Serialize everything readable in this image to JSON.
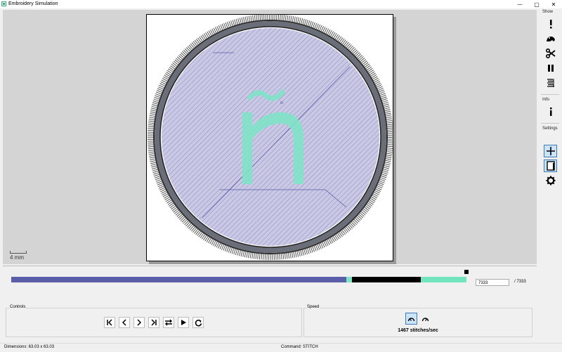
{
  "window": {
    "title": "Embroidery Simulation",
    "controls": {
      "minimize": "—",
      "maximize": "▢",
      "close": "✕"
    }
  },
  "canvas": {
    "scale_label": "4 mm",
    "colors": {
      "background": "#d4d4d4",
      "fill_stitch": "#c8c8e6",
      "satin_border": "#3a3a3a",
      "letter": "#7fe3c8",
      "travel": "#5a5aa8"
    },
    "letter": "ñ"
  },
  "sidebar": {
    "show_label": "Show",
    "info_label": "Info",
    "settings_label": "Settings",
    "show_buttons": [
      "warning-icon",
      "frog-icon",
      "scissors-icon",
      "pause-icon",
      "stitch-list-icon"
    ],
    "info_buttons": [
      "info-icon"
    ],
    "settings_buttons": [
      "crosshair-icon",
      "page-icon",
      "gear-icon"
    ]
  },
  "progress": {
    "current": "7333",
    "total": "/ 7333",
    "fraction": 1.0,
    "segments": [
      {
        "color": "#5a5ea8",
        "fraction": 0.736
      },
      {
        "color": "#7fe3c8",
        "fraction": 0.012
      },
      {
        "color": "#000000",
        "fraction": 0.151
      },
      {
        "color": "#72e4be",
        "fraction": 0.101
      }
    ]
  },
  "controls": {
    "label": "Controls",
    "buttons": [
      "skip-to-start-icon",
      "step-back-icon",
      "step-forward-icon",
      "skip-to-end-icon",
      "swap-direction-icon",
      "play-icon",
      "refresh-icon"
    ]
  },
  "speed": {
    "label": "Speed",
    "value": "1467 stitches/sec",
    "buttons": [
      "slower-icon",
      "faster-icon"
    ]
  },
  "status": {
    "dimensions": "Dimensions: 63.03 x 63.03",
    "command": "Command: STITCH"
  }
}
